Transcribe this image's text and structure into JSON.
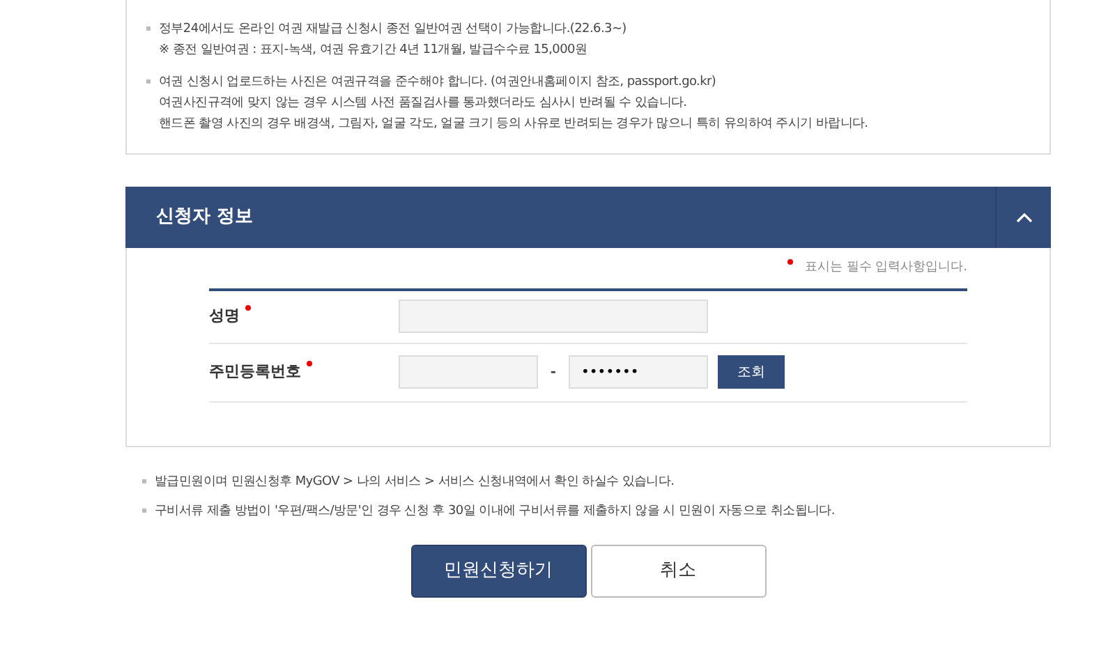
{
  "notice_box": {
    "items": [
      {
        "lines": [
          "정부24에서도 온라인 여권 재발급 신청시 종전 일반여권 선택이 가능합니다.(22.6.3~)",
          "※ 종전 일반여권 : 표지-녹색, 여권 유효기간 4년 11개월, 발급수수료 15,000원"
        ]
      },
      {
        "lines": [
          "여권 신청시 업로드하는 사진은 여권규격을 준수해야 합니다. (여권안내홈페이지 참조, passport.go.kr)",
          "여권사진규격에 맞지 않는 경우 시스템 사전 품질검사를 통과했더라도 심사시 반려될 수 있습니다.",
          "핸드폰 촬영 사진의 경우 배경색, 그림자, 얼굴 각도, 얼굴 크기 등의 사유로 반려되는 경우가 많으니 특히 유의하여 주시기 바랍니다."
        ]
      }
    ]
  },
  "applicant_panel": {
    "title": "신청자 정보",
    "expanded": true,
    "required_note": "표시는 필수 입력사항입니다.",
    "fields": [
      {
        "kind": "single",
        "label": "성명",
        "required": true
      },
      {
        "kind": "split",
        "label": "주민등록번호",
        "required": true,
        "separator": "-",
        "second_value": "•••••••",
        "button": "조회"
      }
    ]
  },
  "notes": [
    "발급민원이며 민원신청후 MyGOV > 나의 서비스 > 서비스 신청내역에서 확인 하실수 있습니다.",
    "구비서류 제출 방법이 '우편/팩스/방문'인 경우 신청 후 30일 이내에 구비서류를 제출하지 않을 시 민원이 자동으로 취소됩니다."
  ],
  "buttons": [
    {
      "label": "민원신청하기",
      "kind": "primary"
    },
    {
      "label": "취소",
      "kind": "secondary"
    }
  ]
}
